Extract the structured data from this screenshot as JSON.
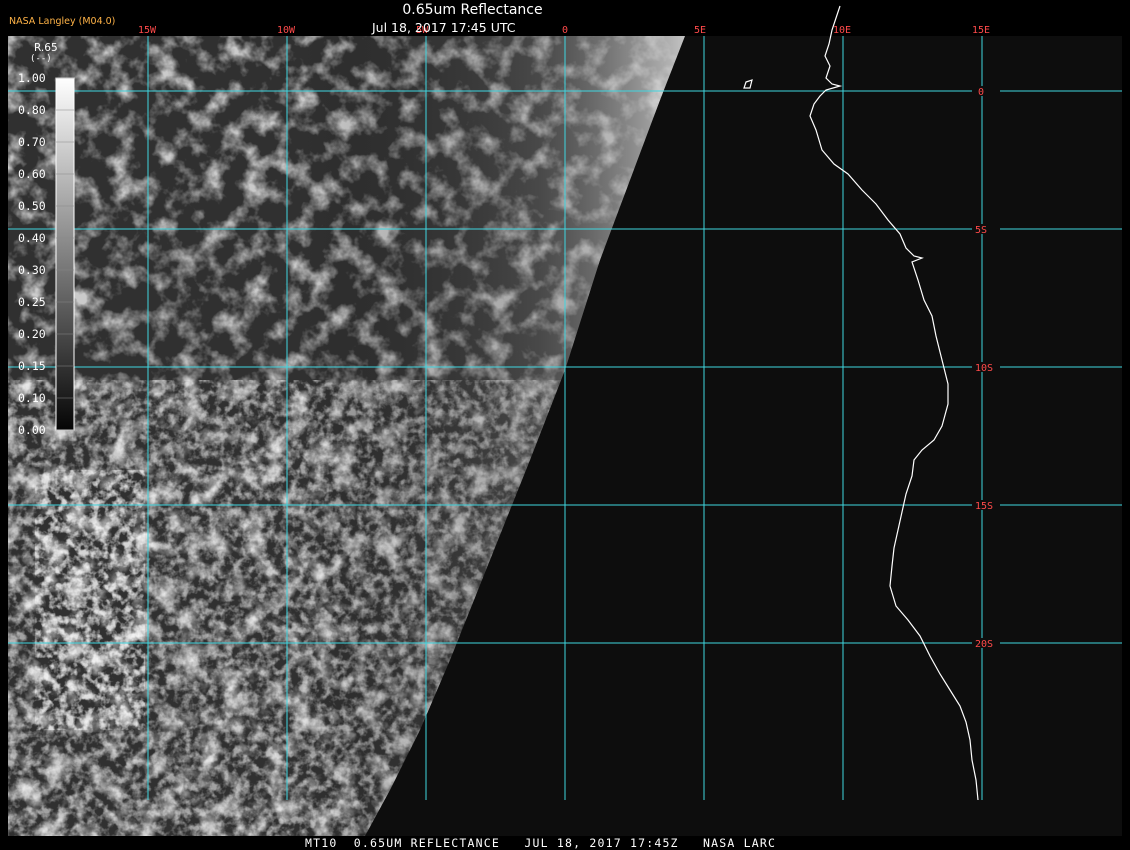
{
  "header": {
    "title": "0.65um Reflectance",
    "datetime": "Jul 18, 2017 17:45 UTC",
    "credit": "NASA Langley (M04.0)"
  },
  "footer": {
    "text": "MT10  0.65UM REFLECTANCE   JUL 18, 2017 17:45Z   NASA LARC"
  },
  "legend": {
    "variable": "R.65",
    "unit": "(--)",
    "ticks": [
      "1.00",
      "0.80",
      "0.70",
      "0.60",
      "0.50",
      "0.40",
      "0.30",
      "0.25",
      "0.20",
      "0.15",
      "0.10",
      "0.00"
    ]
  },
  "grid": {
    "longitudes": [
      {
        "label": "15W",
        "deg": -15
      },
      {
        "label": "10W",
        "deg": -10
      },
      {
        "label": "5W",
        "deg": -5
      },
      {
        "label": "0",
        "deg": 0
      },
      {
        "label": "5E",
        "deg": 5
      },
      {
        "label": "10E",
        "deg": 10
      },
      {
        "label": "15E",
        "deg": 15
      }
    ],
    "latitudes": [
      {
        "label": "0",
        "deg": 0
      },
      {
        "label": "5S",
        "deg": -5
      },
      {
        "label": "10S",
        "deg": -10
      },
      {
        "label": "15S",
        "deg": -15
      },
      {
        "label": "20S",
        "deg": -20
      }
    ]
  },
  "colors": {
    "grid": "#3fd6e0",
    "grid_label": "#ff4a4a",
    "coastline": "#ffffff",
    "space": "#0d0d0d"
  }
}
